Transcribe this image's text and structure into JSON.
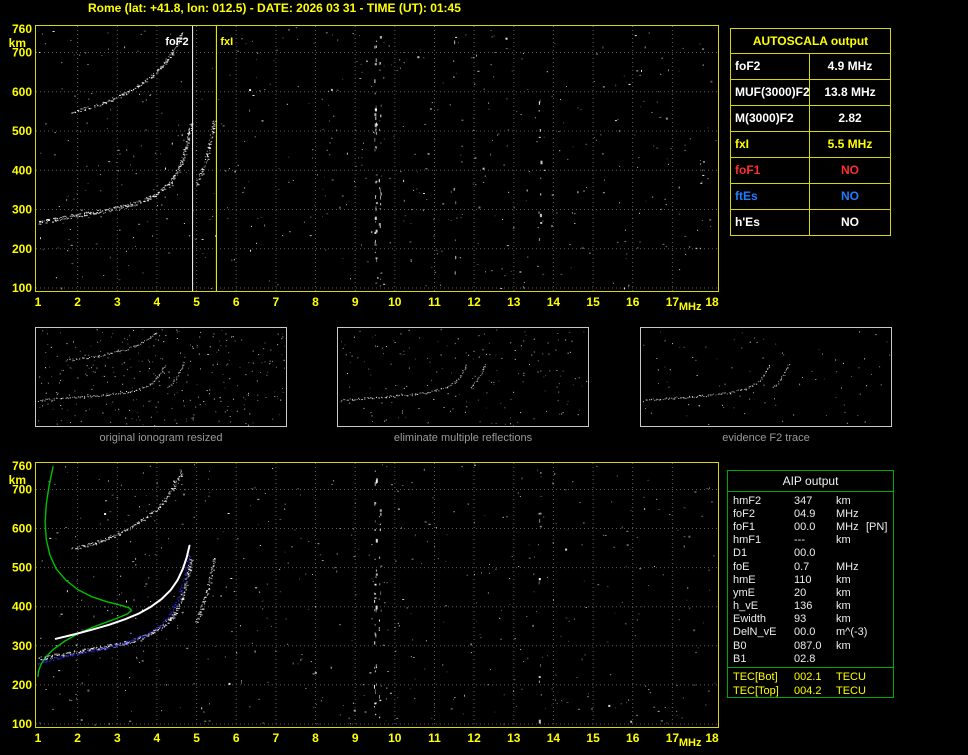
{
  "header": {
    "title": "Rome (lat: +41.8, lon: 012.5) - DATE: 2026 03 31 - TIME (UT): 01:45"
  },
  "colors": {
    "axis": "#ffff00",
    "frame": "#d8d800",
    "grid": "#5c5c5c",
    "trace": "#ffffff",
    "restored_blue": "#3434ff",
    "profile_green": "#00c000",
    "marker_fof2": "#ffffff",
    "marker_fxi": "#ffff00",
    "table_red": "#ff2e2e",
    "table_blue": "#1e7dff",
    "aip_green": "#00a800",
    "caption": "#9a9a9a",
    "thumb_border": "#c8c8c8"
  },
  "axes": {
    "x": {
      "unit": "MHz",
      "min": 1,
      "max": 18,
      "ticks": [
        "1",
        "2",
        "3",
        "4",
        "5",
        "6",
        "7",
        "8",
        "9",
        "10",
        "11",
        "12",
        "13",
        "14",
        "15",
        "16",
        "17",
        "18"
      ]
    },
    "y": {
      "unit": "km",
      "min": 100,
      "max": 760,
      "ticks": [
        "760",
        "700",
        "600",
        "500",
        "400",
        "300",
        "200",
        "100"
      ]
    }
  },
  "autoscala_table": {
    "title": "AUTOSCALA output",
    "rows": [
      {
        "label": "foF2",
        "value": "4.9 MHz",
        "color": "white"
      },
      {
        "label": "MUF(3000)F2",
        "value": "13.8 MHz",
        "color": "white"
      },
      {
        "label": "M(3000)F2",
        "value": "2.82",
        "color": "white"
      },
      {
        "label": "fxI",
        "value": "5.5 MHz",
        "color": "yellow"
      },
      {
        "label": "foF1",
        "value": "NO",
        "color": "red"
      },
      {
        "label": "ftEs",
        "value": "NO",
        "color": "blue"
      },
      {
        "label": "h'Es",
        "value": "NO",
        "color": "white"
      }
    ]
  },
  "thumbnails": [
    {
      "caption": "original ionogram resized",
      "noise_dots": 310,
      "show_second_hop": true
    },
    {
      "caption": "eliminate multiple reflections",
      "noise_dots": 180,
      "show_second_hop": false
    },
    {
      "caption": "evidence F2 trace",
      "noise_dots": 85,
      "show_second_hop": false
    }
  ],
  "aip_table": {
    "title": "AIP output",
    "rows": [
      {
        "name": "hmF2",
        "value": "347",
        "unit": "km",
        "extra": ""
      },
      {
        "name": "foF2",
        "value": "04.9",
        "unit": "MHz",
        "extra": ""
      },
      {
        "name": "foF1",
        "value": "00.0",
        "unit": "MHz",
        "extra": "[PN]"
      },
      {
        "name": "hmF1",
        "value": "---",
        "unit": "km",
        "extra": ""
      },
      {
        "name": "D1",
        "value": "00.0",
        "unit": "",
        "extra": ""
      },
      {
        "name": "foE",
        "value": "0.7",
        "unit": "MHz",
        "extra": ""
      },
      {
        "name": "hmE",
        "value": "110",
        "unit": "km",
        "extra": ""
      },
      {
        "name": "ymE",
        "value": "20",
        "unit": "km",
        "extra": ""
      },
      {
        "name": "h_vE",
        "value": "136",
        "unit": "km",
        "extra": ""
      },
      {
        "name": "Ewidth",
        "value": "93",
        "unit": "km",
        "extra": ""
      },
      {
        "name": "DelN_vE",
        "value": "00.0",
        "unit": "m^(-3)",
        "extra": ""
      },
      {
        "name": "B0",
        "value": "087.0",
        "unit": "km",
        "extra": ""
      },
      {
        "name": "B1",
        "value": "02.8",
        "unit": "",
        "extra": ""
      }
    ],
    "tec_rows": [
      {
        "name": "TEC[Bot]",
        "value": "002.1",
        "unit": "TECU"
      },
      {
        "name": "TEC[Top]",
        "value": "004.2",
        "unit": "TECU"
      }
    ]
  },
  "chart_data": [
    {
      "id": "top",
      "type": "scatter",
      "title": "Autoscaled ionogram",
      "xlabel": "MHz",
      "ylabel": "km",
      "xlim": [
        1,
        18
      ],
      "ylim": [
        100,
        760
      ],
      "x_ticks": [
        1,
        2,
        3,
        4,
        5,
        6,
        7,
        8,
        9,
        10,
        11,
        12,
        13,
        14,
        15,
        16,
        17,
        18
      ],
      "y_ticks": [
        100,
        200,
        300,
        400,
        500,
        600,
        700,
        760
      ],
      "grid": true,
      "markers": [
        {
          "label": "foF2",
          "mhz": 4.9,
          "color": "#ffffff",
          "side": "left"
        },
        {
          "label": "fxI",
          "mhz": 5.5,
          "color": "#ffff00",
          "side": "right"
        }
      ],
      "series": [
        {
          "name": "f2-trace-o-mode",
          "style": "scatter",
          "color": "#ffffff",
          "spread": 4,
          "density": 3,
          "points": [
            [
              1.02,
              266
            ],
            [
              1.25,
              272
            ],
            [
              1.55,
              278
            ],
            [
              1.9,
              284
            ],
            [
              2.25,
              290
            ],
            [
              2.6,
              296
            ],
            [
              2.95,
              303
            ],
            [
              3.25,
              310
            ],
            [
              3.55,
              319
            ],
            [
              3.8,
              330
            ],
            [
              4.02,
              342
            ],
            [
              4.2,
              356
            ],
            [
              4.35,
              372
            ],
            [
              4.47,
              390
            ],
            [
              4.57,
              410
            ],
            [
              4.65,
              432
            ],
            [
              4.72,
              456
            ],
            [
              4.78,
              482
            ],
            [
              4.83,
              508
            ],
            [
              4.87,
              525
            ]
          ]
        },
        {
          "name": "f2-trace-x-mode",
          "style": "scatter",
          "color": "#ffffff",
          "spread": 3,
          "density": 2,
          "points": [
            [
              4.97,
              360
            ],
            [
              5.07,
              382
            ],
            [
              5.16,
              406
            ],
            [
              5.24,
              432
            ],
            [
              5.31,
              460
            ],
            [
              5.37,
              488
            ],
            [
              5.41,
              512
            ],
            [
              5.44,
              528
            ]
          ]
        },
        {
          "name": "f2-second-hop",
          "style": "scatter",
          "color": "#ffffff",
          "spread": 3,
          "density": 2,
          "points": [
            [
              1.85,
              548
            ],
            [
              2.15,
              556
            ],
            [
              2.45,
              565
            ],
            [
              2.75,
              576
            ],
            [
              3.05,
              589
            ],
            [
              3.32,
              603
            ],
            [
              3.57,
              618
            ],
            [
              3.8,
              635
            ],
            [
              4.0,
              653
            ],
            [
              4.18,
              672
            ],
            [
              4.33,
              692
            ],
            [
              4.46,
              713
            ],
            [
              4.56,
              734
            ],
            [
              4.64,
              754
            ]
          ]
        }
      ],
      "noise": {
        "seed": 7,
        "count": 520
      },
      "streaks": [
        {
          "mhz": 9.5,
          "count": 42
        },
        {
          "mhz": 9.62,
          "count": 22
        },
        {
          "mhz": 13.65,
          "count": 12
        },
        {
          "mhz": 11.5,
          "count": 8
        }
      ]
    },
    {
      "id": "bottom",
      "type": "scatter",
      "title": "Ionogram with AIP restored trace and electron density profile",
      "xlabel": "MHz",
      "ylabel": "km",
      "xlim": [
        1,
        18
      ],
      "ylim": [
        100,
        760
      ],
      "x_ticks": [
        1,
        2,
        3,
        4,
        5,
        6,
        7,
        8,
        9,
        10,
        11,
        12,
        13,
        14,
        15,
        16,
        17,
        18
      ],
      "y_ticks": [
        100,
        200,
        300,
        400,
        500,
        600,
        700,
        760
      ],
      "grid": true,
      "markers": [],
      "series": [
        {
          "name": "electron-density-profile",
          "style": "line",
          "color": "#00c000",
          "width": 1.4,
          "points": [
            [
              1.38,
              758
            ],
            [
              1.28,
              710
            ],
            [
              1.21,
              662
            ],
            [
              1.18,
              616
            ],
            [
              1.21,
              572
            ],
            [
              1.3,
              532
            ],
            [
              1.46,
              497
            ],
            [
              1.7,
              468
            ],
            [
              2.0,
              444
            ],
            [
              2.35,
              426
            ],
            [
              2.72,
              413
            ],
            [
              3.08,
              404
            ],
            [
              3.3,
              397
            ],
            [
              3.36,
              390
            ],
            [
              3.24,
              381
            ],
            [
              3.0,
              371
            ],
            [
              2.68,
              359
            ],
            [
              2.32,
              345
            ],
            [
              1.97,
              329
            ],
            [
              1.66,
              311
            ],
            [
              1.4,
              292
            ],
            [
              1.2,
              272
            ],
            [
              1.07,
              252
            ],
            [
              1.01,
              234
            ],
            [
              1.0,
              222
            ]
          ]
        },
        {
          "name": "f2-trace-o-mode",
          "style": "scatter",
          "color": "#ffffff",
          "spread": 4,
          "density": 3,
          "points": [
            [
              1.02,
              266
            ],
            [
              1.25,
              272
            ],
            [
              1.55,
              278
            ],
            [
              1.9,
              284
            ],
            [
              2.25,
              290
            ],
            [
              2.6,
              296
            ],
            [
              2.95,
              303
            ],
            [
              3.25,
              310
            ],
            [
              3.55,
              319
            ],
            [
              3.8,
              330
            ],
            [
              4.02,
              342
            ],
            [
              4.2,
              356
            ],
            [
              4.35,
              372
            ],
            [
              4.47,
              390
            ],
            [
              4.57,
              410
            ],
            [
              4.65,
              432
            ],
            [
              4.72,
              456
            ],
            [
              4.78,
              482
            ],
            [
              4.83,
              508
            ],
            [
              4.87,
              525
            ]
          ]
        },
        {
          "name": "f2-trace-x-mode",
          "style": "scatter",
          "color": "#ffffff",
          "spread": 3,
          "density": 2,
          "points": [
            [
              4.97,
              360
            ],
            [
              5.07,
              382
            ],
            [
              5.16,
              406
            ],
            [
              5.24,
              432
            ],
            [
              5.31,
              460
            ],
            [
              5.37,
              488
            ],
            [
              5.41,
              512
            ],
            [
              5.44,
              528
            ]
          ]
        },
        {
          "name": "f2-second-hop",
          "style": "scatter",
          "color": "#ffffff",
          "spread": 3,
          "density": 2,
          "points": [
            [
              1.85,
              548
            ],
            [
              2.15,
              556
            ],
            [
              2.45,
              565
            ],
            [
              2.75,
              576
            ],
            [
              3.05,
              589
            ],
            [
              3.32,
              603
            ],
            [
              3.57,
              618
            ],
            [
              3.8,
              635
            ],
            [
              4.0,
              653
            ],
            [
              4.18,
              672
            ],
            [
              4.33,
              692
            ],
            [
              4.46,
              713
            ],
            [
              4.56,
              734
            ],
            [
              4.64,
              754
            ]
          ]
        },
        {
          "name": "restored-f2-trace",
          "style": "scatter",
          "color": "#3434ff",
          "spread": 2.5,
          "density": 2,
          "points": [
            [
              1.02,
              258
            ],
            [
              1.35,
              266
            ],
            [
              1.7,
              274
            ],
            [
              2.05,
              281
            ],
            [
              2.4,
              288
            ],
            [
              2.75,
              296
            ],
            [
              3.1,
              305
            ],
            [
              3.4,
              315
            ],
            [
              3.68,
              327
            ],
            [
              3.92,
              341
            ],
            [
              4.12,
              357
            ],
            [
              4.28,
              375
            ],
            [
              4.42,
              396
            ],
            [
              4.53,
              420
            ],
            [
              4.62,
              447
            ],
            [
              4.7,
              477
            ],
            [
              4.76,
              508
            ],
            [
              4.81,
              538
            ]
          ]
        },
        {
          "name": "fitted-trace",
          "style": "line",
          "color": "#ffffff",
          "width": 2,
          "points": [
            [
              1.45,
              318
            ],
            [
              1.9,
              329
            ],
            [
              2.35,
              341
            ],
            [
              2.8,
              354
            ],
            [
              3.2,
              368
            ],
            [
              3.55,
              383
            ],
            [
              3.85,
              400
            ],
            [
              4.12,
              420
            ],
            [
              4.35,
              443
            ],
            [
              4.52,
              468
            ],
            [
              4.65,
              496
            ],
            [
              4.75,
              526
            ],
            [
              4.82,
              556
            ]
          ]
        }
      ],
      "noise": {
        "seed": 11,
        "count": 500
      },
      "streaks": [
        {
          "mhz": 9.5,
          "count": 36
        },
        {
          "mhz": 9.62,
          "count": 18
        },
        {
          "mhz": 13.65,
          "count": 10
        }
      ]
    }
  ]
}
